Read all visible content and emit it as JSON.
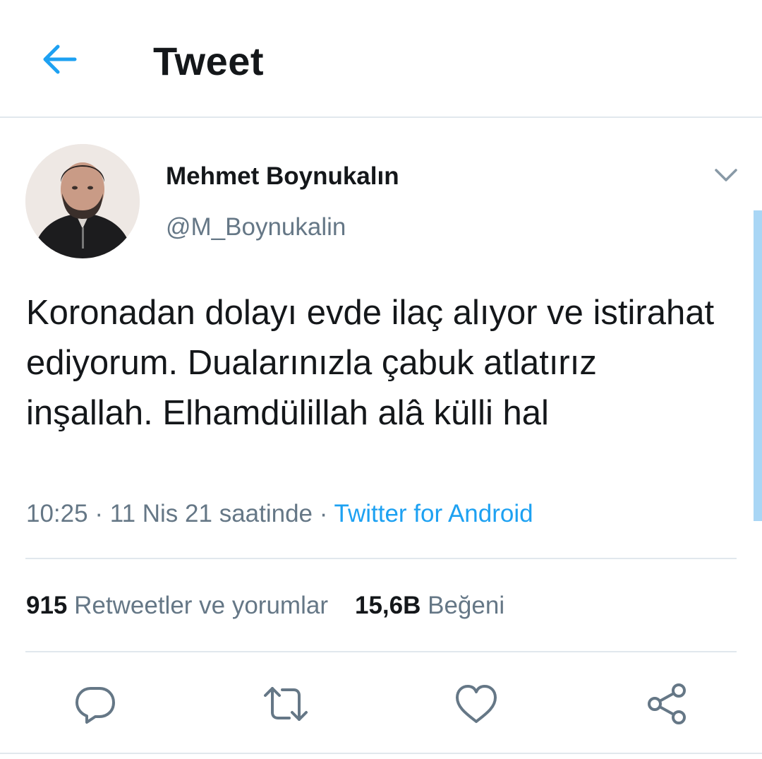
{
  "header": {
    "title": "Tweet",
    "back_icon": "arrow-left-icon",
    "accent_color": "#1da1f2"
  },
  "tweet": {
    "user": {
      "name": "Mehmet Boynukalın",
      "handle": "@M_Boynukalin"
    },
    "text": "Koronadan dolayı evde ilaç alıyor ve istirahat ediyorum. Dualarınızla çabuk atlatırız inşallah. Elhamdülillah alâ külli hal",
    "time": "10:25",
    "separator": " · ",
    "date": "11 Nis 21 saatinde",
    "source": "Twitter for Android"
  },
  "stats": {
    "retweets_count": "915",
    "retweets_label": "Retweetler ve yorumlar",
    "likes_count": "15,6B",
    "likes_label": "Beğeni"
  },
  "actions": [
    "reply-icon",
    "retweet-icon",
    "like-icon",
    "share-icon"
  ],
  "colors": {
    "text": "#14171a",
    "secondary": "#657786",
    "divider": "#e1e8ed"
  }
}
